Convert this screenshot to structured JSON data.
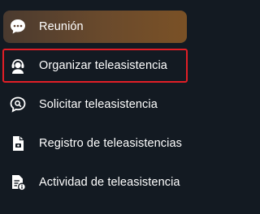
{
  "menu": {
    "items": [
      {
        "label": "Reunión",
        "icon": "chat-bubble-icon",
        "state": "active"
      },
      {
        "label": "Organizar teleasistencia",
        "icon": "headset-user-icon",
        "state": "highlighted"
      },
      {
        "label": "Solicitar teleasistencia",
        "icon": "chat-search-icon",
        "state": "normal"
      },
      {
        "label": "Registro de teleasistencias",
        "icon": "document-register-icon",
        "state": "normal"
      },
      {
        "label": "Actividad de teleasistencia",
        "icon": "document-info-icon",
        "state": "normal"
      }
    ]
  },
  "colors": {
    "background": "#131a22",
    "active_gradient_start": "#4a3a2f",
    "active_gradient_end": "#7a5126",
    "highlight_border": "#e21e26",
    "text": "#ffffff"
  }
}
